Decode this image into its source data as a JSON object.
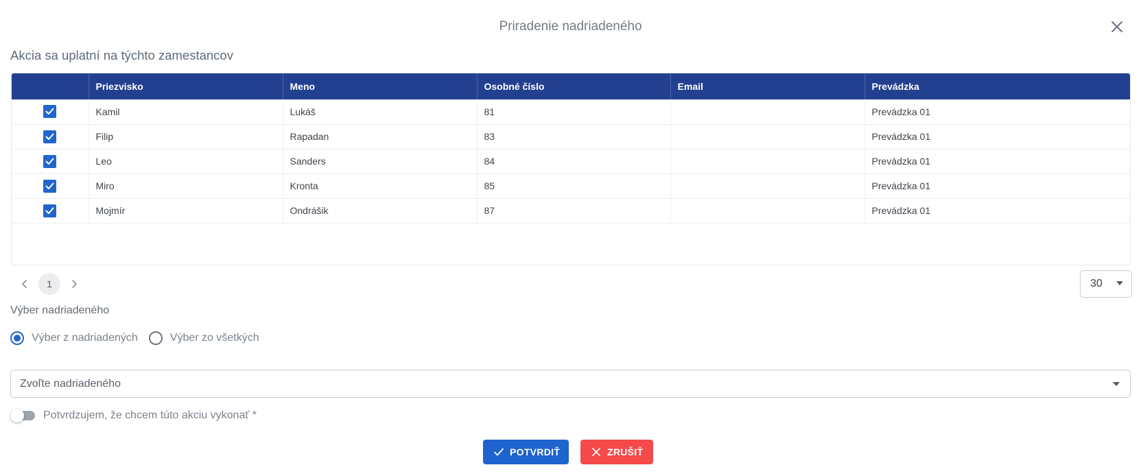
{
  "dialog": {
    "title": "Priradenie nadriadeného",
    "subtitle": "Akcia sa uplatní na týchto zamestancov"
  },
  "table": {
    "columns": [
      "",
      "Priezvisko",
      "Meno",
      "Osobné číslo",
      "Email",
      "Prevádzka"
    ],
    "rows": [
      {
        "checked": true,
        "priezvisko": "Kamil",
        "meno": "Lukáš",
        "osobne_cislo": "81",
        "email": "",
        "prevadzka": "Prevádzka 01"
      },
      {
        "checked": true,
        "priezvisko": "Filip",
        "meno": "Rapadan",
        "osobne_cislo": "83",
        "email": "",
        "prevadzka": "Prevádzka 01"
      },
      {
        "checked": true,
        "priezvisko": "Leo",
        "meno": "Sanders",
        "osobne_cislo": "84",
        "email": "",
        "prevadzka": "Prevádzka 01"
      },
      {
        "checked": true,
        "priezvisko": "Miro",
        "meno": "Kronta",
        "osobne_cislo": "85",
        "email": "",
        "prevadzka": "Prevádzka 01"
      },
      {
        "checked": true,
        "priezvisko": "Mojmír",
        "meno": "Ondrášik",
        "osobne_cislo": "87",
        "email": "",
        "prevadzka": "Prevádzka 01"
      }
    ]
  },
  "pagination": {
    "current_page": "1",
    "page_size": "30"
  },
  "supervisor": {
    "section_label": "Výber nadriadeného",
    "radio_options": [
      {
        "label": "Výber z nadriadených",
        "selected": true
      },
      {
        "label": "Výber zo všetkých",
        "selected": false
      }
    ],
    "select_placeholder": "Zvoľte nadriadeného"
  },
  "confirm_toggle": {
    "label": "Potvrdzujem, že chcem túto akciu vykonať *",
    "on": false
  },
  "buttons": {
    "confirm": "POTVRDIŤ",
    "cancel": "ZRUŠIŤ"
  },
  "colors": {
    "header_bg": "#234090",
    "primary": "#2166cc",
    "danger": "#f44a4a"
  },
  "icons": {
    "close": "close-icon",
    "checkbox": "check-icon",
    "prev": "chevron-left-icon",
    "next": "chevron-right-icon",
    "confirm": "check-icon",
    "cancel": "x-icon"
  }
}
